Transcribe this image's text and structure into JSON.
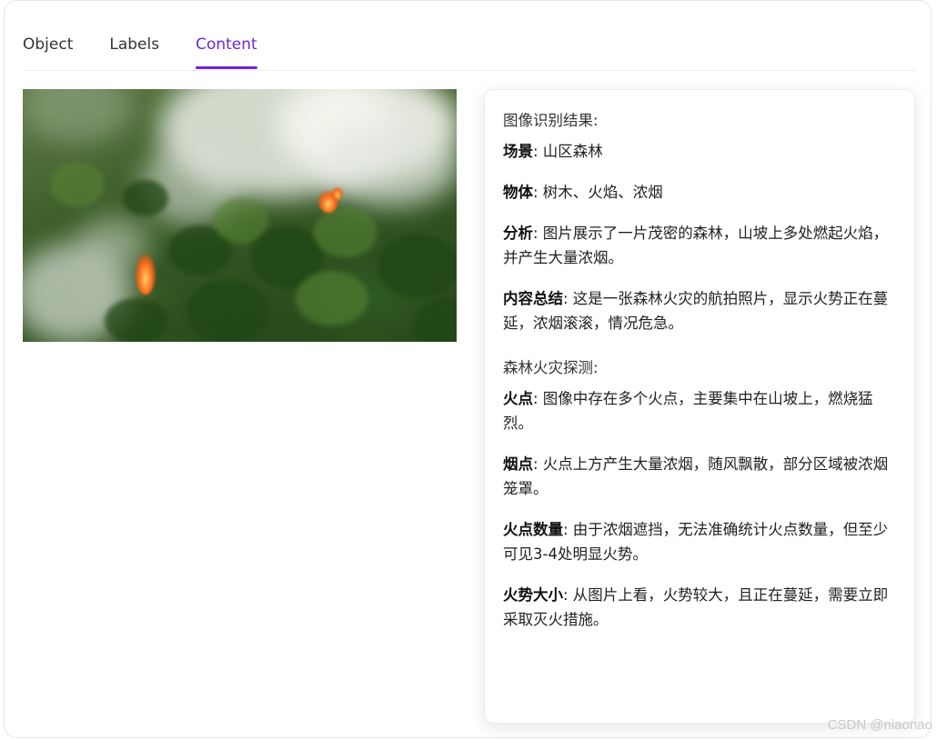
{
  "tabs": [
    {
      "label": "Object",
      "active": false
    },
    {
      "label": "Labels",
      "active": false
    },
    {
      "label": "Content",
      "active": true
    }
  ],
  "colors": {
    "accent": "#6d28d9",
    "border": "#ececec"
  },
  "image": {
    "description_icon": "forest-fire-aerial-photo"
  },
  "result": {
    "recognition_title": "图像识别结果:",
    "recognition_items": [
      {
        "key": "场景",
        "value": ": 山区森林"
      },
      {
        "key": "物体",
        "value": ": 树木、火焰、浓烟"
      },
      {
        "key": "分析",
        "value": ": 图片展示了一片茂密的森林，山坡上多处燃起火焰，并产生大量浓烟。"
      },
      {
        "key": "内容总结",
        "value": ": 这是一张森林火灾的航拍照片，显示火势正在蔓延，浓烟滚滚，情况危急。"
      }
    ],
    "detection_title": "森林火灾探测:",
    "detection_items": [
      {
        "key": "火点",
        "value": ": 图像中存在多个火点，主要集中在山坡上，燃烧猛烈。"
      },
      {
        "key": "烟点",
        "value": ": 火点上方产生大量浓烟，随风飘散，部分区域被浓烟笼罩。"
      },
      {
        "key": "火点数量",
        "value": ": 由于浓烟遮挡，无法准确统计火点数量，但至少可见3-4处明显火势。"
      },
      {
        "key": "火势大小",
        "value": ": 从图片上看，火势较大，且正在蔓延，需要立即采取灭火措施。"
      }
    ]
  },
  "watermark": "CSDN @niaonao"
}
